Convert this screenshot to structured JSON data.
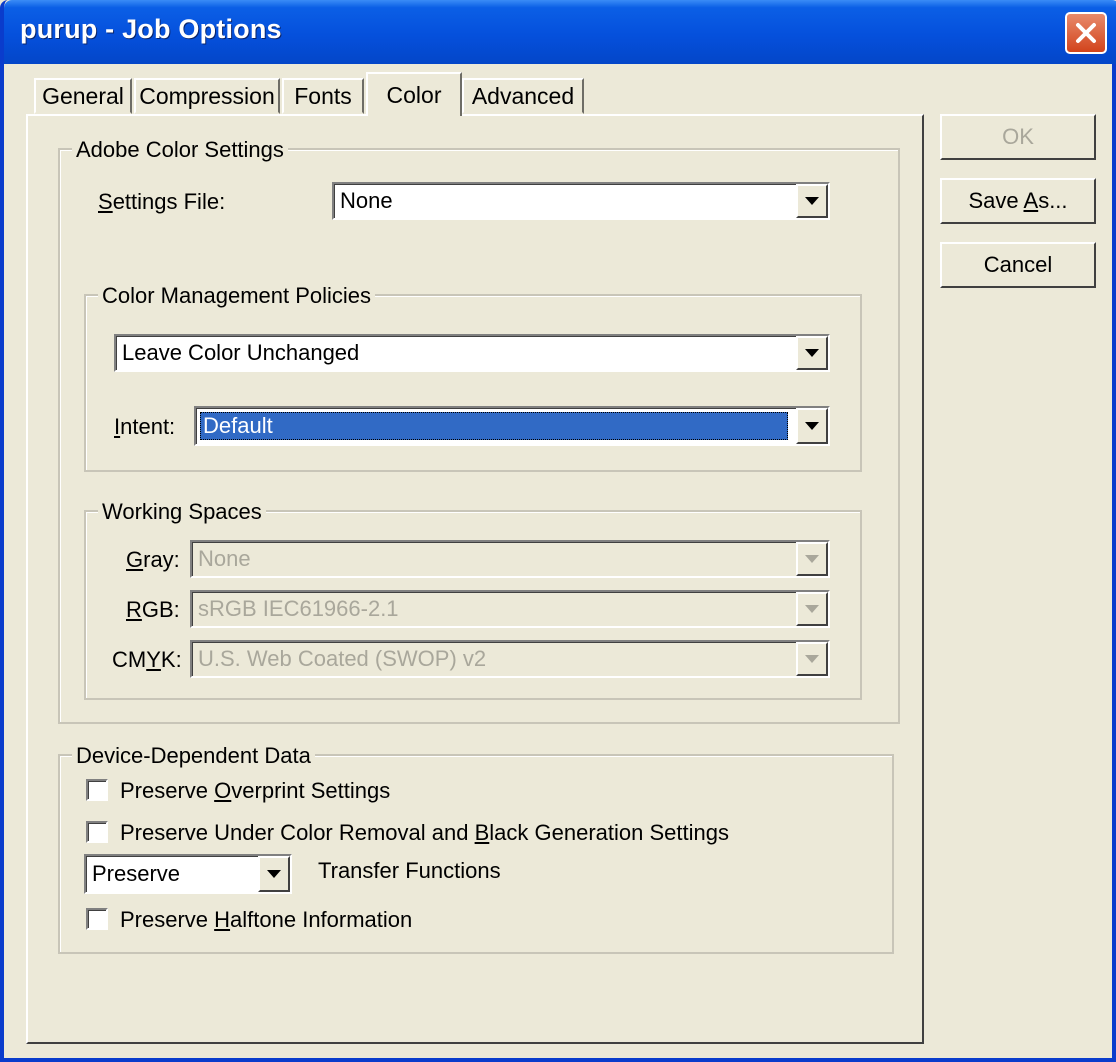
{
  "window": {
    "title": "purup - Job Options"
  },
  "tabs": [
    {
      "label": "General"
    },
    {
      "label": "Compression"
    },
    {
      "label": "Fonts"
    },
    {
      "label": "Color",
      "active": true
    },
    {
      "label": "Advanced"
    }
  ],
  "buttons": {
    "ok": {
      "label": "OK",
      "enabled": false
    },
    "save_as": {
      "label_pre": "Save ",
      "label_key": "A",
      "label_post": "s..."
    },
    "cancel": {
      "label": "Cancel"
    }
  },
  "adobe_color_settings": {
    "legend": "Adobe Color Settings",
    "settings_file": {
      "label_key": "S",
      "label_rest": "ettings File:",
      "value": "None"
    },
    "policies": {
      "legend": "Color Management Policies",
      "policy_value": "Leave Color Unchanged",
      "intent": {
        "label_key": "I",
        "label_rest": "ntent:",
        "value": "Default"
      }
    },
    "working_spaces": {
      "legend": "Working Spaces",
      "gray": {
        "label_key": "G",
        "label_rest": "ray:",
        "value": "None"
      },
      "rgb": {
        "label_key": "R",
        "label_rest": "GB:",
        "value": "sRGB IEC61966-2.1"
      },
      "cmyk": {
        "label_pre": "CM",
        "label_key": "Y",
        "label_rest": "K:",
        "value": "U.S. Web Coated (SWOP) v2"
      }
    }
  },
  "device_dependent": {
    "legend": "Device-Dependent Data",
    "overprint": {
      "pre": "Preserve ",
      "key": "O",
      "post": "verprint Settings",
      "checked": false
    },
    "ucr": {
      "pre": "Preserve Under Color Removal and ",
      "key": "B",
      "post": "lack Generation Settings",
      "checked": false
    },
    "transfer": {
      "value": "Preserve",
      "label": "Transfer Functions"
    },
    "halftone": {
      "pre": "Preserve ",
      "key": "H",
      "post": "alftone Information",
      "checked": false
    }
  },
  "icons": {
    "close": "close-icon",
    "dropdown": "chevron-down-icon"
  },
  "colors": {
    "titlebar": "#0550dc",
    "close": "#d2441c",
    "selection": "#316ac5",
    "face": "#ece9d8"
  }
}
